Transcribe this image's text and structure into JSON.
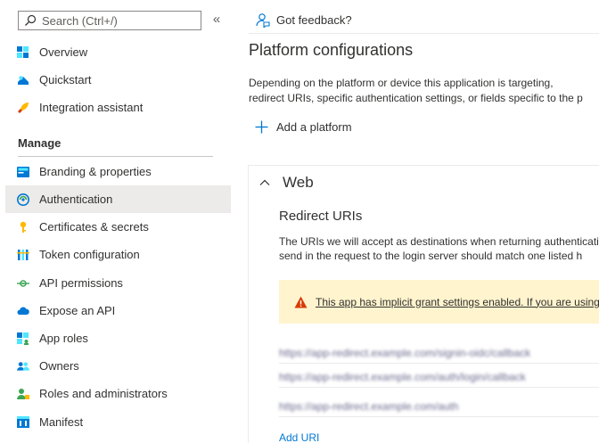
{
  "search": {
    "placeholder": "Search (Ctrl+/)"
  },
  "collapse_label": "«",
  "sidebar": {
    "items_top": [
      {
        "label": "Overview",
        "icon": "overview-icon"
      },
      {
        "label": "Quickstart",
        "icon": "quickstart-icon"
      },
      {
        "label": "Integration assistant",
        "icon": "rocket-icon"
      }
    ],
    "section_label": "Manage",
    "items_manage": [
      {
        "label": "Branding & properties",
        "icon": "branding-icon"
      },
      {
        "label": "Authentication",
        "icon": "authentication-icon",
        "active": true
      },
      {
        "label": "Certificates & secrets",
        "icon": "key-icon"
      },
      {
        "label": "Token configuration",
        "icon": "token-icon"
      },
      {
        "label": "API permissions",
        "icon": "api-permissions-icon"
      },
      {
        "label": "Expose an API",
        "icon": "cloud-icon"
      },
      {
        "label": "App roles",
        "icon": "app-roles-icon"
      },
      {
        "label": "Owners",
        "icon": "owners-icon"
      },
      {
        "label": "Roles and administrators",
        "icon": "roles-admin-icon"
      },
      {
        "label": "Manifest",
        "icon": "manifest-icon"
      }
    ]
  },
  "main": {
    "feedback_label": "Got feedback?",
    "page_title": "Platform configurations",
    "description_line1": "Depending on the platform or device this application is targeting,",
    "description_line2": "redirect URIs, specific authentication settings, or fields specific to the p",
    "add_platform_label": "Add a platform",
    "web": {
      "header": "Web",
      "redirect_title": "Redirect URIs",
      "redirect_desc_line1": "The URIs we will accept as destinations when returning authenticati",
      "redirect_desc_line2": "send in the request to the login server should match one listed h",
      "warning_text": "This app has implicit grant settings enabled. If you are using a",
      "uris": [
        "https://app-redirect.example.com/signin-oidc/callback",
        "https://app-redirect.example.com/auth/login/callback",
        "https://app-redirect.example.com/auth"
      ],
      "add_uri_label": "Add URI"
    }
  },
  "colors": {
    "accent": "#0078d4",
    "active_bg": "#edebe9",
    "warning_bg": "#fff4ce",
    "warning_icon": "#d83b01"
  }
}
